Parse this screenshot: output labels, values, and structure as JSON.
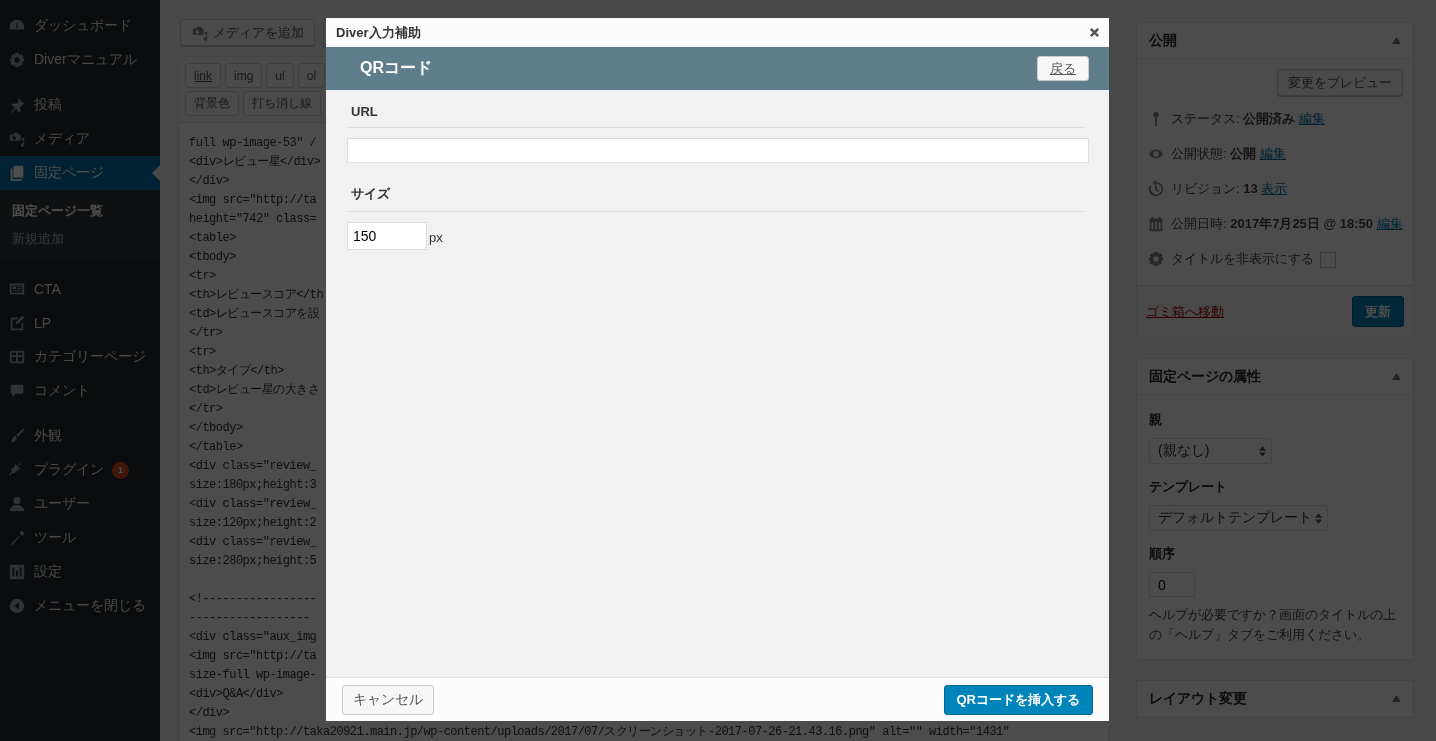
{
  "sidebar": {
    "items": [
      {
        "label": "ダッシュボード",
        "selected": false
      },
      {
        "label": "Diverマニュアル",
        "selected": false
      },
      {
        "label": "投稿",
        "selected": false
      },
      {
        "label": "メディア",
        "selected": false
      },
      {
        "label": "固定ページ",
        "selected": true,
        "children": [
          {
            "label": "固定ページ一覧",
            "selected": true
          },
          {
            "label": "新規追加",
            "selected": false
          }
        ]
      },
      {
        "label": "CTA",
        "selected": false
      },
      {
        "label": "LP",
        "selected": false
      },
      {
        "label": "カテゴリーページ",
        "selected": false
      },
      {
        "label": "コメント",
        "selected": false
      },
      {
        "label": "外観",
        "selected": false
      },
      {
        "label": "プラグイン",
        "selected": false,
        "badge": "1"
      },
      {
        "label": "ユーザー",
        "selected": false
      },
      {
        "label": "ツール",
        "selected": false
      },
      {
        "label": "設定",
        "selected": false
      }
    ],
    "collapse": "メニューを閉じる"
  },
  "editor": {
    "media_button": "メディアを追加",
    "quicktags": [
      [
        "link",
        "img",
        "ul",
        "ol"
      ],
      [
        "背景色",
        "打ち消し線"
      ]
    ],
    "lines": [
      [
        "full wp-image-53\" /",
        "<div>レビュー星</div>",
        "</div>",
        "<img src=\"http://ta",
        "height=\"742\" class=",
        "<table>",
        "<tbody>",
        "<tr>",
        "<th>レビュースコア</th",
        "<td>レビュースコアを設",
        "</tr>",
        "<tr>",
        "<th>タイプ</th>",
        "<td>レビュー星の大きさ",
        "</tr>",
        "</tbody>",
        "</table>",
        "<div class=\"review_",
        "size:180px;height:3",
        "<div class=\"review_",
        "size:120px;height:2",
        "<div class=\"review_",
        "size:280px;height:5"
      ],
      [
        "<!-----------------",
        "------------------",
        "<div class=\"aux_img",
        "<img src=\"http://ta",
        "size-full wp-image-",
        "<div>Q&A</div>",
        "</div>",
        "<img src=\"http://taka20921.main.jp/wp-content/uploads/2017/07/スクリーンショット-2017-07-26-21.43.16.png\" alt=\"\" width=\"1431\""
      ]
    ]
  },
  "publish": {
    "title": "公開",
    "preview_button": "変更をプレビュー",
    "rows": [
      {
        "label": "ステータス:",
        "value": "公開済み",
        "link": "編集"
      },
      {
        "label": "公開状態:",
        "value": "公開",
        "link": "編集"
      },
      {
        "label": "リビジョン:",
        "value": "13",
        "link": "表示"
      },
      {
        "label": "公開日時:",
        "value": "2017年7月25日 @ 18:50",
        "link": "編集"
      }
    ],
    "hide_title": {
      "label": "タイトルを非表示にする",
      "checked": false
    },
    "trash_link": "ゴミ箱へ移動",
    "update_button": "更新"
  },
  "page_attributes": {
    "title": "固定ページの属性",
    "parent_label": "親",
    "parent_value": "(親なし)",
    "template_label": "テンプレート",
    "template_value": "デフォルトテンプレート",
    "order_label": "順序",
    "order_value": "0",
    "help": "ヘルプが必要ですか？画面のタイトルの上の「ヘルプ」タブをご利用ください。"
  },
  "layout_box": {
    "title": "レイアウト変更"
  },
  "modal": {
    "title": "Diver入力補助",
    "header": "QRコード",
    "back_button": "戻る",
    "fields": [
      {
        "label": "URL"
      },
      {
        "label": "サイズ",
        "value": "150",
        "unit": "px"
      }
    ],
    "cancel_button": "キャンセル",
    "insert_button": "QRコードを挿入する"
  }
}
